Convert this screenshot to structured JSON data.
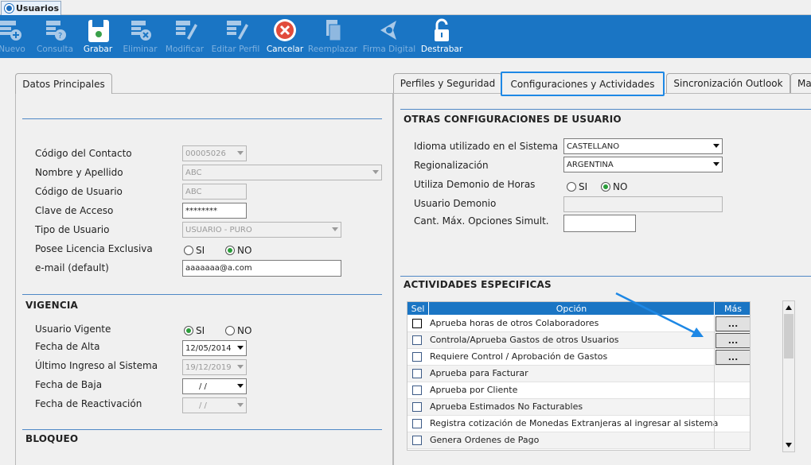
{
  "window_tab": {
    "title": "Usuarios"
  },
  "toolbar": [
    {
      "label": "Nuevo",
      "enabled": false,
      "icon": "new-user-icon"
    },
    {
      "label": "Consulta",
      "enabled": false,
      "icon": "query-user-icon"
    },
    {
      "label": "Grabar",
      "enabled": true,
      "icon": "save-icon"
    },
    {
      "label": "Eliminar",
      "enabled": false,
      "icon": "delete-user-icon"
    },
    {
      "label": "Modificar",
      "enabled": false,
      "icon": "edit-icon"
    },
    {
      "label": "Editar Perfil",
      "enabled": false,
      "icon": "edit-profile-icon"
    },
    {
      "label": "Cancelar",
      "enabled": true,
      "icon": "cancel-icon"
    },
    {
      "label": "Reemplazar",
      "enabled": false,
      "icon": "replace-icon"
    },
    {
      "label": "Firma Digital",
      "enabled": false,
      "icon": "digital-signature-icon"
    },
    {
      "label": "Destrabar",
      "enabled": true,
      "icon": "unlock-icon"
    }
  ],
  "left_panel": {
    "tab": "Datos Principales",
    "fields": {
      "codigo_contacto": {
        "label": "Código del Contacto",
        "value": "00005026"
      },
      "nombre": {
        "label": "Nombre y Apellido",
        "value": "ABC"
      },
      "codigo_usuario": {
        "label": "Código de Usuario",
        "value": "ABC"
      },
      "clave": {
        "label": "Clave de Acceso",
        "value": "********"
      },
      "tipo_usuario": {
        "label": "Tipo de Usuario",
        "value": "USUARIO - PURO"
      },
      "licencia": {
        "label": "Posee Licencia Exclusiva",
        "options": [
          "SI",
          "NO"
        ],
        "selected": "NO"
      },
      "email": {
        "label": "e-mail (default)",
        "value": "aaaaaaa@a.com"
      }
    },
    "vigencia": {
      "title": "VIGENCIA",
      "usuario_vigente": {
        "label": "Usuario Vigente",
        "options": [
          "SI",
          "NO"
        ],
        "selected": "SI"
      },
      "fecha_alta": {
        "label": "Fecha de Alta",
        "value": "12/05/2014"
      },
      "ultimo_ingreso": {
        "label": "Último Ingreso al Sistema",
        "value": "19/12/2019"
      },
      "fecha_baja": {
        "label": "Fecha de Baja",
        "value": " /  /"
      },
      "fecha_reactivacion": {
        "label": "Fecha de Reactivación",
        "value": " /  /"
      }
    },
    "bloqueo": {
      "title": "BLOQUEO"
    }
  },
  "right_panel": {
    "tabs": [
      "Perfiles y Seguridad",
      "Configuraciones y Actividades",
      "Sincronización Outlook",
      "Ma"
    ],
    "active_tab": "Configuraciones y Actividades",
    "otras": {
      "title": "OTRAS CONFIGURACIONES DE USUARIO",
      "idioma": {
        "label": "Idioma utilizado en el Sistema",
        "value": "CASTELLANO"
      },
      "regionalizacion": {
        "label": "Regionalización",
        "value": "ARGENTINA"
      },
      "demonio_horas": {
        "label": "Utiliza Demonio de Horas",
        "options": [
          "SI",
          "NO"
        ],
        "selected": "NO"
      },
      "usuario_demonio": {
        "label": "Usuario Demonio",
        "value": ""
      },
      "cant_max": {
        "label": "Cant. Máx. Opciones Simult.",
        "value": ""
      }
    },
    "actividades": {
      "title": "ACTIVIDADES ESPECIFICAS",
      "columns": [
        "Sel",
        "Opción",
        "Más"
      ],
      "rows": [
        {
          "opcion": "Aprueba horas de otros Colaboradores",
          "mas": "..."
        },
        {
          "opcion": "Controla/Aprueba Gastos de otros Usuarios",
          "mas": "..."
        },
        {
          "opcion": "Requiere Control / Aprobación de Gastos",
          "mas": "..."
        },
        {
          "opcion": "Aprueba para Facturar",
          "mas": ""
        },
        {
          "opcion": "Aprueba por Cliente",
          "mas": ""
        },
        {
          "opcion": "Aprueba Estimados No Facturables",
          "mas": ""
        },
        {
          "opcion": "Registra cotización de Monedas Extranjeras al ingresar al sistema",
          "mas": ""
        },
        {
          "opcion": "Genera Ordenes de Pago",
          "mas": ""
        }
      ]
    }
  },
  "colors": {
    "toolbar": "#1a75c4",
    "accent_line": "#4f88c6",
    "radio_selected": "#2a9d3a",
    "highlight": "#1e88e5"
  }
}
